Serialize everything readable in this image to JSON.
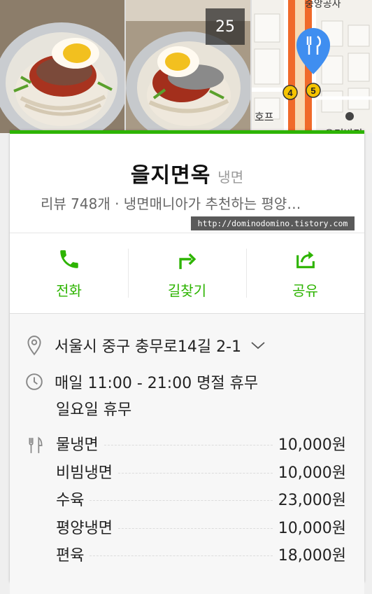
{
  "photos": {
    "count_label": "25",
    "map_labels": {
      "top": "중앙공사",
      "hof": "호프",
      "bottom": "오기바다"
    },
    "map_markers": [
      "4",
      "5"
    ]
  },
  "place": {
    "name": "을지면옥",
    "category": "냉면",
    "summary": "리뷰 748개 · 냉면매니아가 추천하는 평양…"
  },
  "watermark": "http://dominodomino.tistory.com",
  "actions": [
    {
      "label": "전화",
      "icon": "phone-icon"
    },
    {
      "label": "길찾기",
      "icon": "directions-icon"
    },
    {
      "label": "공유",
      "icon": "share-icon"
    }
  ],
  "info": {
    "address": "서울시 중구 충무로14길 2-1",
    "hours_line1": "매일 11:00 - 21:00 명절 휴무",
    "hours_line2": "일요일 휴무"
  },
  "menu": [
    {
      "name": "물냉면",
      "price": "10,000원"
    },
    {
      "name": "비빔냉면",
      "price": "10,000원"
    },
    {
      "name": "수육",
      "price": "23,000원"
    },
    {
      "name": "평양냉면",
      "price": "10,000원"
    },
    {
      "name": "편육",
      "price": "18,000원"
    }
  ],
  "colors": {
    "accent": "#2db400",
    "map_route": "#f06a2a",
    "pin": "#3f8ef0"
  }
}
